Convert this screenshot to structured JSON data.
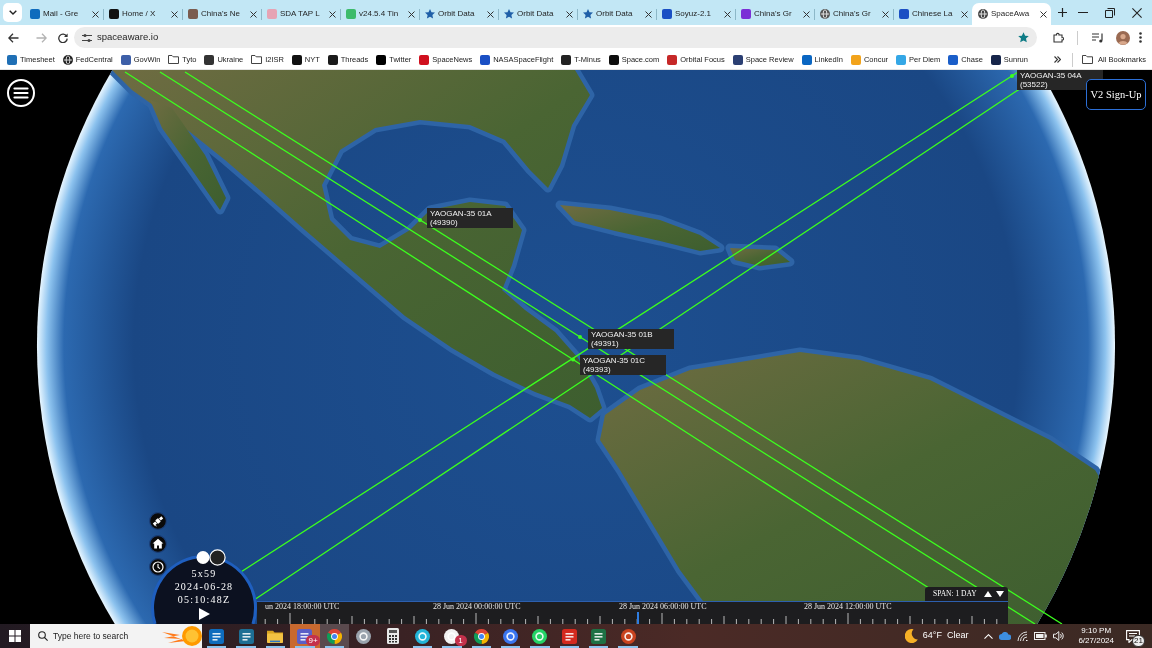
{
  "browser": {
    "tabs": [
      {
        "title": "Mail - Gre",
        "selected": false,
        "kind": "tile",
        "color": "#0f6cbd"
      },
      {
        "title": "Home / X",
        "selected": false,
        "kind": "tile",
        "color": "#111111"
      },
      {
        "title": "China's Ne",
        "selected": false,
        "kind": "tile",
        "color": "#7a5c4f"
      },
      {
        "title": "SDA TAP L",
        "selected": false,
        "kind": "tile",
        "color": "#e6a3b4"
      },
      {
        "title": "v24.5.4 Tin",
        "selected": false,
        "kind": "tile",
        "color": "#3dbb6b"
      },
      {
        "title": "Orbit Data",
        "selected": false,
        "kind": "star",
        "color": "#1f5fa8"
      },
      {
        "title": "Orbit Data",
        "selected": false,
        "kind": "star",
        "color": "#1f5fa8"
      },
      {
        "title": "Orbit Data",
        "selected": false,
        "kind": "star",
        "color": "#1f5fa8"
      },
      {
        "title": "Soyuz-2.1",
        "selected": false,
        "kind": "tile",
        "color": "#1a4fc4"
      },
      {
        "title": "China's Gr",
        "selected": false,
        "kind": "tile",
        "color": "#7b2fd6"
      },
      {
        "title": "China's Gr",
        "selected": false,
        "kind": "globe",
        "color": "#555555"
      },
      {
        "title": "Chinese La",
        "selected": false,
        "kind": "tile",
        "color": "#1a4fc4"
      },
      {
        "title": "SpaceAwa",
        "selected": true,
        "kind": "globe",
        "color": "#444444"
      }
    ],
    "address": "spaceaware.io",
    "forward_disabled": true,
    "bookmarked": true,
    "bookmarks": [
      {
        "label": "Timesheet",
        "kind": "tile",
        "color": "#1f6fb5"
      },
      {
        "label": "FedCentral",
        "kind": "globe",
        "color": "#222222"
      },
      {
        "label": "GovWin",
        "kind": "tile",
        "color": "#3d5fa8"
      },
      {
        "label": "Tyto",
        "kind": "folder"
      },
      {
        "label": "Ukraine",
        "kind": "tile",
        "color": "#333333"
      },
      {
        "label": "I2ISR",
        "kind": "folder"
      },
      {
        "label": "NYT",
        "kind": "tile",
        "color": "#111111"
      },
      {
        "label": "Threads",
        "kind": "tile",
        "color": "#1a1a1a"
      },
      {
        "label": "Twitter",
        "kind": "tile",
        "color": "#000000"
      },
      {
        "label": "SpaceNews",
        "kind": "tile",
        "color": "#d0101e"
      },
      {
        "label": "NASASpaceFlight",
        "kind": "tile",
        "color": "#1a4fc4"
      },
      {
        "label": "T-Minus",
        "kind": "tile",
        "color": "#222222"
      },
      {
        "label": "Space.com",
        "kind": "tile",
        "color": "#0d0d0d"
      },
      {
        "label": "Orbital Focus",
        "kind": "tile",
        "color": "#c62828"
      },
      {
        "label": "Space Review",
        "kind": "tile",
        "color": "#2b3f73"
      },
      {
        "label": "LinkedIn",
        "kind": "tile",
        "color": "#0a66c2"
      },
      {
        "label": "Concur",
        "kind": "tile",
        "color": "#f2a31b"
      },
      {
        "label": "Per Diem",
        "kind": "tile",
        "color": "#34a7e6"
      },
      {
        "label": "Chase",
        "kind": "tile",
        "color": "#1a5ec9"
      },
      {
        "label": "Sunrun",
        "kind": "tile",
        "color": "#16254a"
      }
    ],
    "all_bookmarks": "All Bookmarks"
  },
  "map": {
    "satellites": [
      {
        "name": "YAOGAN-35 01A",
        "number": "(49390)"
      },
      {
        "name": "YAOGAN-35 01B",
        "number": "(49391)"
      },
      {
        "name": "YAOGAN-35 01C",
        "number": "(49393)"
      },
      {
        "name": "YAOGAN-35 04A",
        "number": "(53522)"
      }
    ],
    "sign_up": "V2 Sign-Up",
    "clock": {
      "rate": "5x59",
      "date": "2024-06-28",
      "time": "05:10:48Z",
      "playing": false
    },
    "timeline": {
      "labels": [
        "un 2024 18:00:00 UTC",
        "28 Jun 2024 00:00:00 UTC",
        "28 Jun 2024 06:00:00 UTC",
        "28 Jun 2024 12:00:00 UTC"
      ],
      "span": "SPAN: 1 DAY"
    }
  },
  "taskbar": {
    "search": {
      "placeholder": "Type here to search"
    },
    "apps": [
      {
        "kind": "tile",
        "color": "#0f6cbd",
        "running": true,
        "active": false,
        "attention": false
      },
      {
        "kind": "tile",
        "color": "#1d6e94",
        "running": true,
        "active": false,
        "attention": false
      },
      {
        "kind": "folder",
        "color": "#f3c243",
        "running": true,
        "active": false,
        "attention": false
      },
      {
        "kind": "tile",
        "color": "#5b5fc7",
        "running": true,
        "active": false,
        "attention": true,
        "badge": "9+"
      },
      {
        "kind": "chrome",
        "running": true,
        "active": true,
        "attention": false
      },
      {
        "kind": "round",
        "color": "#9aa3ad",
        "running": false,
        "active": false,
        "attention": false
      },
      {
        "kind": "calculator",
        "color": "#e9e9e9",
        "running": false,
        "active": false,
        "attention": false
      },
      {
        "kind": "round",
        "color": "#22b5d9",
        "running": true,
        "active": false,
        "attention": false
      },
      {
        "kind": "round",
        "color": "#f2f2f2",
        "running": true,
        "active": false,
        "attention": false,
        "badge": "1"
      },
      {
        "kind": "chrome",
        "running": true,
        "active": false,
        "attention": false
      },
      {
        "kind": "round",
        "color": "#3a76f0",
        "running": true,
        "active": false,
        "attention": false
      },
      {
        "kind": "round",
        "color": "#25d366",
        "running": true,
        "active": false,
        "attention": false
      },
      {
        "kind": "tile",
        "color": "#d42a1e",
        "running": true,
        "active": false,
        "attention": false
      },
      {
        "kind": "tile",
        "color": "#1e7145",
        "running": true,
        "active": false,
        "attention": false
      },
      {
        "kind": "round",
        "color": "#c9431f",
        "running": true,
        "active": false,
        "attention": false
      }
    ],
    "weather": {
      "temperature": "64°F",
      "condition": "Clear"
    },
    "time": "9:10 PM",
    "date": "6/27/2024",
    "notifications": "21"
  }
}
